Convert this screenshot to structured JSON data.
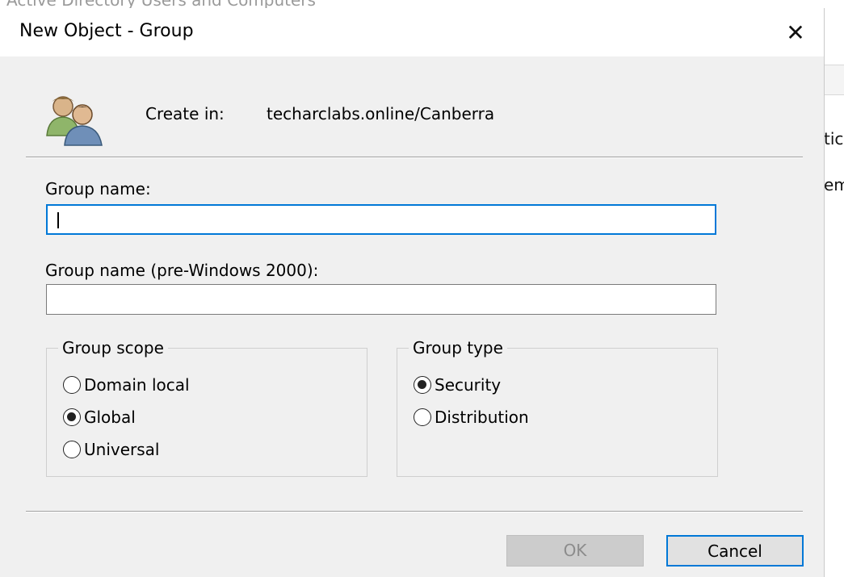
{
  "background": {
    "top_text": "Active Directory Users and Computers",
    "side_text_1": "tic",
    "side_text_2": "em"
  },
  "dialog": {
    "title": "New Object - Group",
    "close_glyph": "✕",
    "create_in_label": "Create in:",
    "create_in_path": "techarclabs.online/Canberra",
    "group_name_label": "Group name:",
    "group_name_value": "",
    "group_name_pre2000_label": "Group name (pre-Windows 2000):",
    "group_name_pre2000_value": "",
    "group_scope": {
      "legend": "Group scope",
      "options": [
        "Domain local",
        "Global",
        "Universal"
      ],
      "selected": "Global"
    },
    "group_type": {
      "legend": "Group type",
      "options": [
        "Security",
        "Distribution"
      ],
      "selected": "Security"
    },
    "buttons": {
      "ok": "OK",
      "cancel": "Cancel"
    }
  },
  "colors": {
    "accent": "#0078d7",
    "dialog_bg": "#f0f0f0",
    "disabled_text": "#8c8c8c"
  },
  "icons": {
    "group_icon": "users-icon"
  }
}
